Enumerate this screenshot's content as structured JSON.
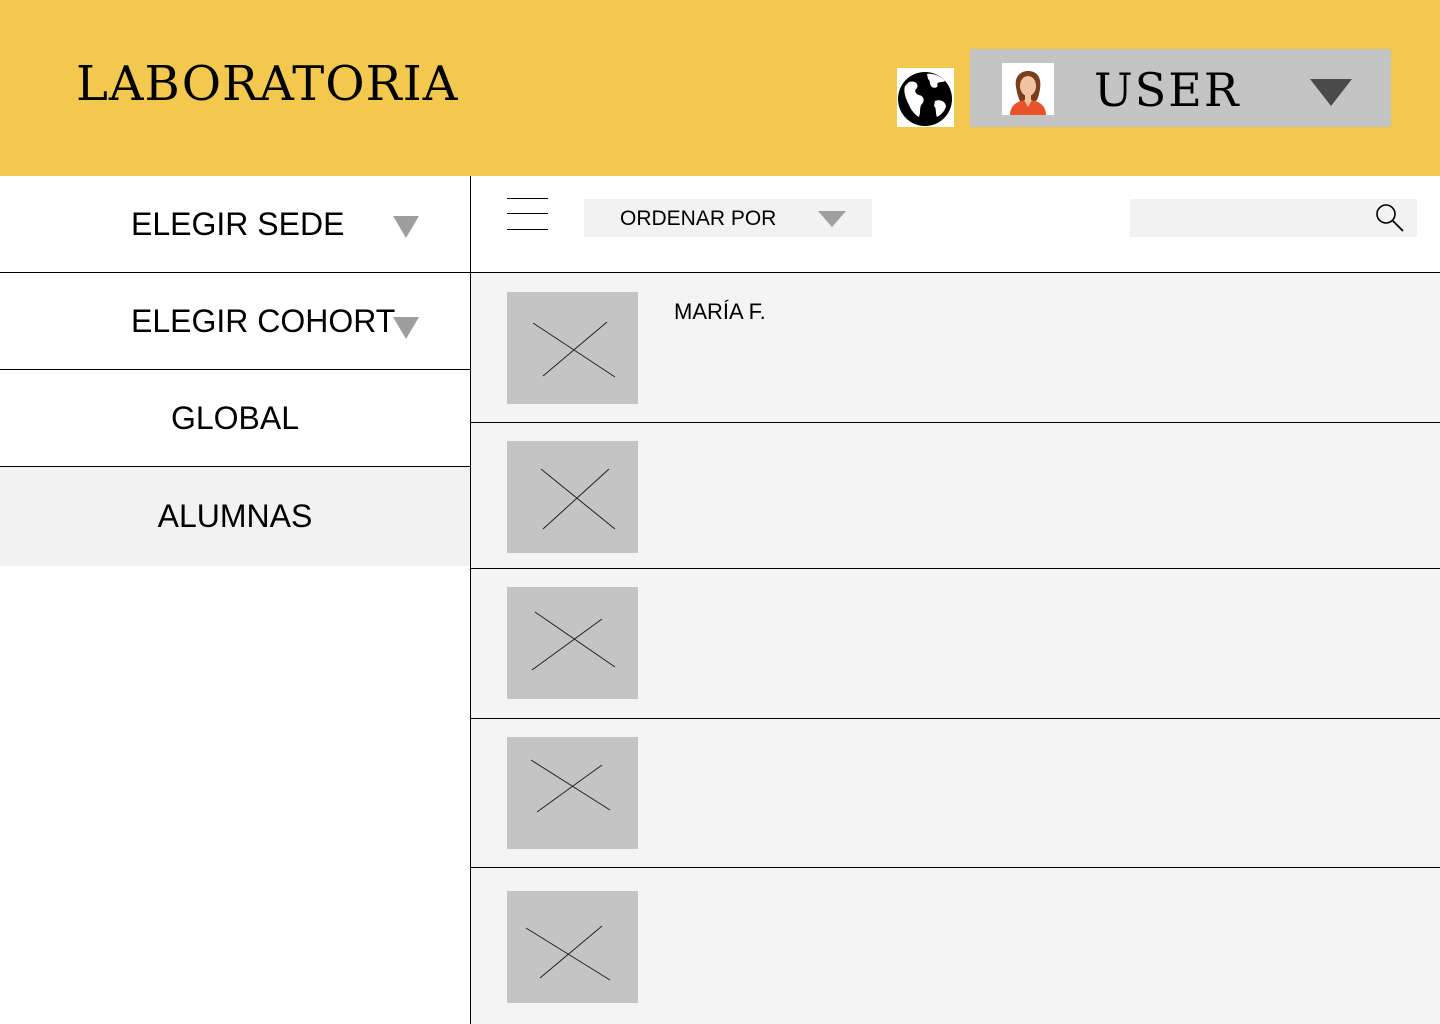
{
  "header": {
    "brand": "LABORATORIA",
    "globe_icon": "globe-icon",
    "user": {
      "label": "USER",
      "avatar_icon": "avatar-woman-icon",
      "caret_icon": "caret-down-icon"
    },
    "background": "#f2c84e"
  },
  "sidebar": {
    "items": [
      {
        "label": "ELEGIR SEDE",
        "has_dropdown": true
      },
      {
        "label": "ELEGIR COHORT",
        "has_dropdown": true
      },
      {
        "label": "GLOBAL",
        "has_dropdown": false
      },
      {
        "label": "ALUMNAS",
        "has_dropdown": false,
        "selected": true
      }
    ]
  },
  "toolbar": {
    "menu_icon": "hamburger-icon",
    "sort_label": "ORDENAR POR",
    "search_value": "",
    "search_icon": "search-icon"
  },
  "list": {
    "rows": [
      {
        "name": "MARÍA F."
      },
      {
        "name": ""
      },
      {
        "name": ""
      },
      {
        "name": ""
      },
      {
        "name": ""
      }
    ],
    "placeholder_icon": "image-placeholder-icon"
  }
}
